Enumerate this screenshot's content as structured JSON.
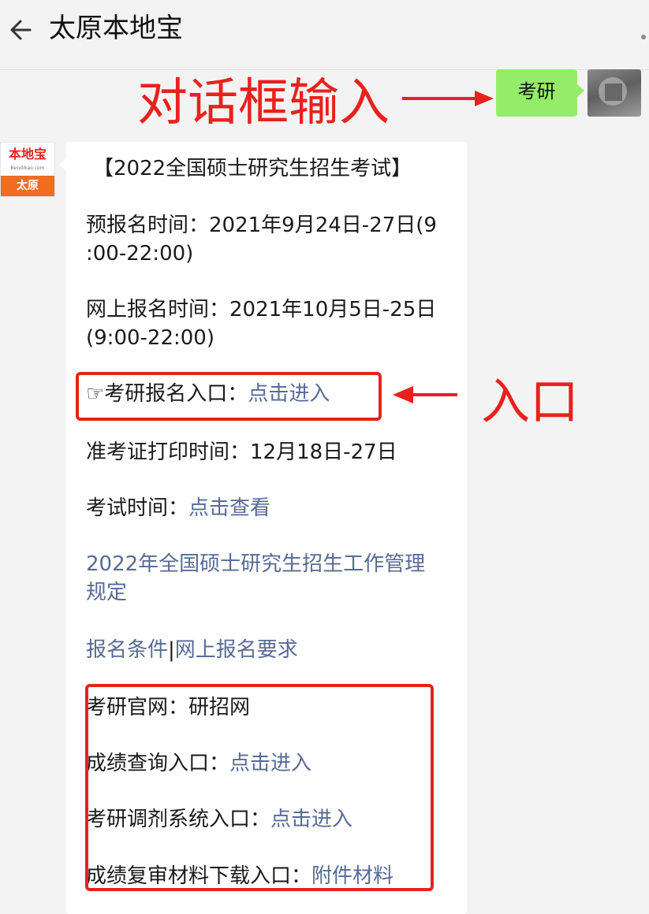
{
  "header": {
    "title": "太原本地宝",
    "back_icon": "back-arrow-icon",
    "more_icon": "more-dots-icon"
  },
  "annotations": {
    "dialog_input": "对话框输入",
    "entry": "入口",
    "color": "#e8211d"
  },
  "user_message": {
    "text": "考研",
    "bubble_color": "#95ec69"
  },
  "bot_avatar": {
    "brand": "本地宝",
    "url": "Bendibao.com",
    "city": "太原"
  },
  "reply": {
    "title": "【2022全国硕士研究生招生考试】",
    "prereg_label": "预报名时间：",
    "prereg_line1": "2021年9月24日-27日(9",
    "prereg_line2": ":00-22:00)",
    "online_label": "网上报名时间：",
    "online_line1": "2021年10月5日-25日",
    "online_line2": "(9:00-22:00)",
    "entry_prefix": "☞考研报名入口：",
    "entry_link": "点击进入",
    "admit_label": "准考证打印时间：",
    "admit_value": "12月18日-27日",
    "exam_label": "考试时间：",
    "exam_link": "点击查看",
    "rules_link_line1": "2022年全国硕士研究生招生工作管理",
    "rules_link_line2": "规定",
    "cond_link": "报名条件",
    "separator": "|",
    "req_link": "网上报名要求",
    "official_label": "考研官网：",
    "official_value": "研招网",
    "score_label": "成绩查询入口：",
    "score_link": "点击进入",
    "adjust_label": "考研调剂系统入口：",
    "adjust_link": "点击进入",
    "review_label": "成绩复审材料下载入口：",
    "review_link": "附件材料",
    "link_color": "#576b95"
  }
}
